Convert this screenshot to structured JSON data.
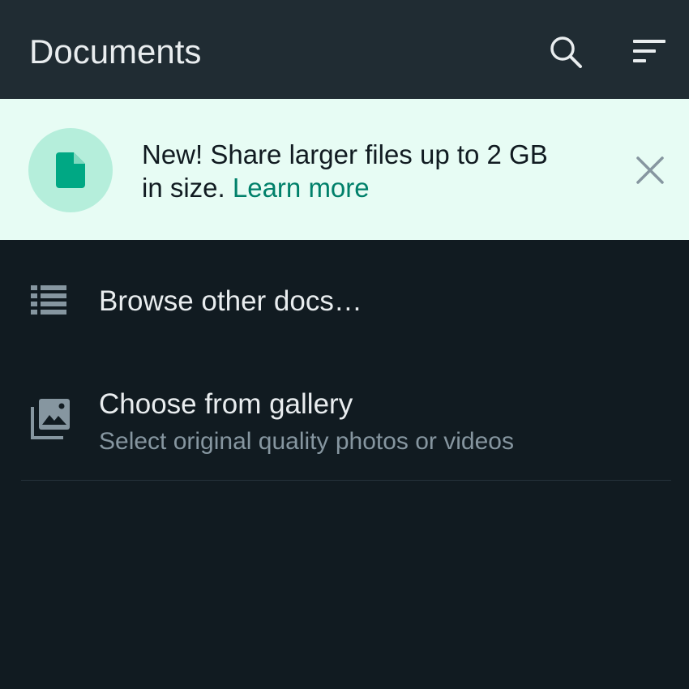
{
  "header": {
    "title": "Documents",
    "search_icon": "search-icon",
    "sort_icon": "sort-icon"
  },
  "banner": {
    "icon": "file-icon",
    "text": "New! Share larger files up to 2 GB in size. ",
    "link": "Learn more",
    "close_icon": "close-icon"
  },
  "options": {
    "browse": {
      "icon": "list-icon",
      "title": "Browse other docs…"
    },
    "gallery": {
      "icon": "gallery-icon",
      "title": "Choose from gallery",
      "subtitle": "Select original quality photos or videos"
    }
  },
  "colors": {
    "header_bg": "#202c33",
    "page_bg": "#111b21",
    "banner_bg": "#e7fcf4",
    "accent": "#00806a",
    "file_icon": "#00a884"
  }
}
